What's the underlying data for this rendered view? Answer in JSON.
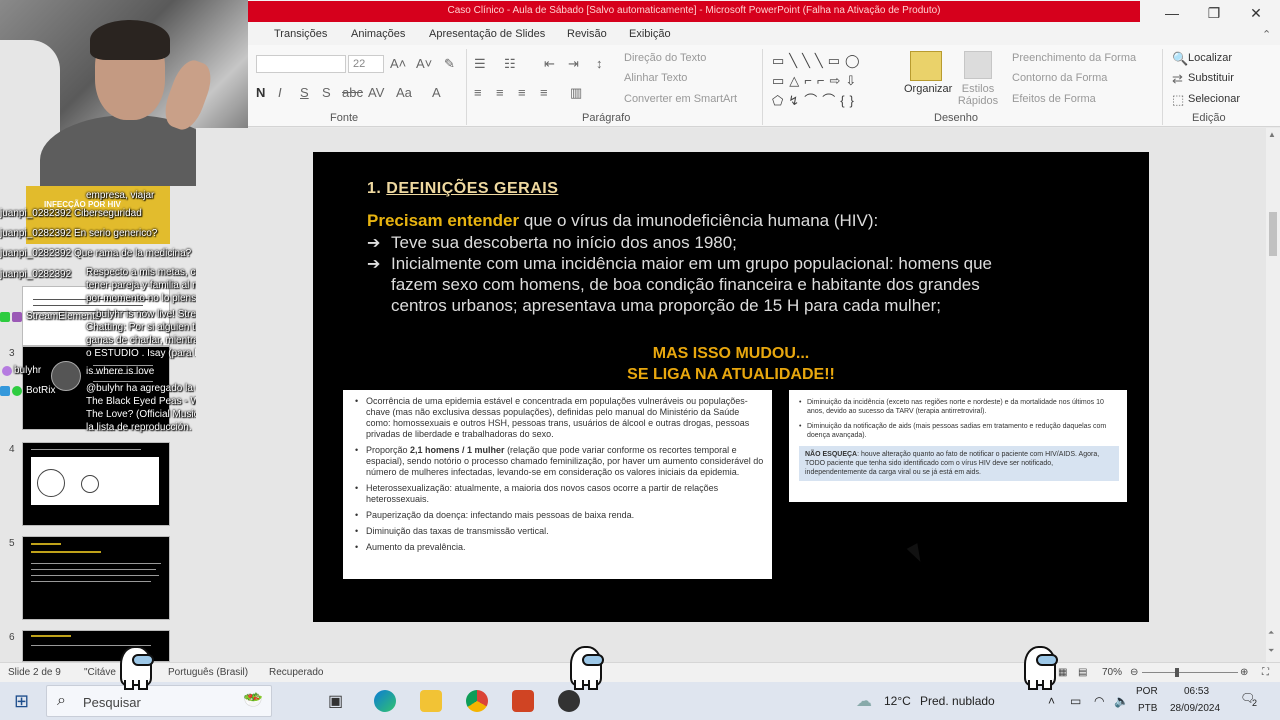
{
  "window": {
    "title": "Caso Clínico - Aula de Sábado [Salvo automaticamente] - Microsoft PowerPoint (Falha na Ativação de Produto)",
    "colors": {
      "titlebar_accent": "#d6001c",
      "slide_bg": "#000000",
      "heading": "#efd9a0",
      "highlight": "#e8b410"
    }
  },
  "ribbon": {
    "tabs": [
      "Transições",
      "Animações",
      "Apresentação de Slides",
      "Revisão",
      "Exibição"
    ],
    "font_size": "22",
    "groups": [
      "Fonte",
      "Parágrafo",
      "Desenho",
      "Edição"
    ],
    "paragraph": {
      "text_direction": "Direção do Texto",
      "align_text": "Alinhar Texto",
      "convert_smartart": "Converter em SmartArt"
    },
    "drawing": {
      "organize": "Organizar",
      "quick_styles": "Estilos Rápidos",
      "shape_fill": "Preenchimento da Forma",
      "shape_outline": "Contorno da Forma",
      "shape_effects": "Efeitos de Forma"
    },
    "editing": {
      "find": "Localizar",
      "replace": "Substituir",
      "select": "Selecionar"
    }
  },
  "thumbnails": {
    "numbers": [
      "3",
      "4",
      "5",
      "6"
    ],
    "slide1_title": "INFECÇÃO POR HIV"
  },
  "chat": {
    "lines": [
      "empresa, viajar",
      "juanpi_0282392 Ciberseguridad",
      "juanpi_0282392 En serio generico?",
      "juanpi_0282392 Que rama de la medicina?",
      "juanpi_0282392",
      "Respecto a mis metas, creo que",
      "tener pareja y familia al menos",
      "por momento no lo pienso",
      "StreamElements",
      "bulyhr is now live! Streaming Just",
      "Chatting: Por si alguien tiene",
      "ganas de charlar, mientras juego",
      "o ESTUDIO . Isay (para hablar)",
      "bulyhr",
      "is where is love",
      "BotRix",
      "@bulyhr ha agregado la canción:",
      "The Black Eyed Peas - Where Is",
      "The Love? (Official Music Video) a",
      "la lista de reproducción."
    ]
  },
  "slide": {
    "heading_num": "1.",
    "heading": "DEFINIÇÕES GERAIS",
    "intro_highlight": "Precisam entender",
    "intro_rest": " que o vírus da imunodeficiência humana (HIV):",
    "bullet1": "Teve sua descoberta no início dos anos 1980;",
    "bullet2_l1": "Inicialmente com uma incidência maior em um grupo populacional: homens que",
    "bullet2_l2": "fazem sexo com homens, de boa condição financeira e habitante dos grandes",
    "bullet2_l3": "centros urbanos; apresentava uma proporção de 15 H para cada mulher;",
    "warn1": "MAS ISSO MUDOU...",
    "warn2": "SE LIGA NA ATUALIDADE!!",
    "left_box": [
      "Ocorrência de uma epidemia estável e concentrada em populações vulneráveis ou populações-chave (mas não exclusiva dessas populações), definidas pelo manual do Ministério da Saúde como: homossexuais e outros HSH, pessoas trans, usuários de álcool e outras drogas, pessoas privadas de liberdade e trabalhadoras do sexo.",
      "Heterossexualização: atualmente, a maioria dos novos casos ocorre a partir de relações heterossexuais.",
      "Pauperização da doença: infectando mais pessoas de baixa renda.",
      "Diminuição das taxas de transmissão vertical.",
      "Aumento da prevalência."
    ],
    "left_box_prop_pre": "Proporção ",
    "left_box_prop_bold": "2,1 homens / 1 mulher",
    "left_box_prop_post": " (relação que pode variar conforme os recortes temporal e espacial), sendo notório o processo chamado feminilização, por haver um aumento considerável do número de mulheres infectadas, levando-se em consideração os valores iniciais da epidemia.",
    "right_box": [
      "Diminuição da incidência (exceto nas regiões norte e nordeste) e da mortalidade nos últimos 10 anos, devido ao sucesso da TARV (terapia antirretroviral).",
      "Diminuição da notificação de aids (mais pessoas sadias em tratamento e redução daquelas com doença avançada)."
    ],
    "note_bold": "NÃO ESQUEÇA",
    "note_rest": ": houve alteração quanto ao fato de notificar o paciente com HIV/AIDS. Agora, TODO paciente que tenha sido identificado com o vírus HIV deve ser notificado, independentemente da carga viral ou se já está em aids."
  },
  "status": {
    "slide": "Slide 2 de 9",
    "theme": "\"Citáve",
    "language": "Português (Brasil)",
    "recovered": "Recuperado",
    "zoom": "70%"
  },
  "taskbar": {
    "search_placeholder": "Pesquisar",
    "weather_temp": "12°C",
    "weather_desc": "Pred. nublado",
    "lang1": "POR",
    "lang2": "PTB",
    "time": "06:53",
    "date": "28/09/2024",
    "notif": "2"
  }
}
